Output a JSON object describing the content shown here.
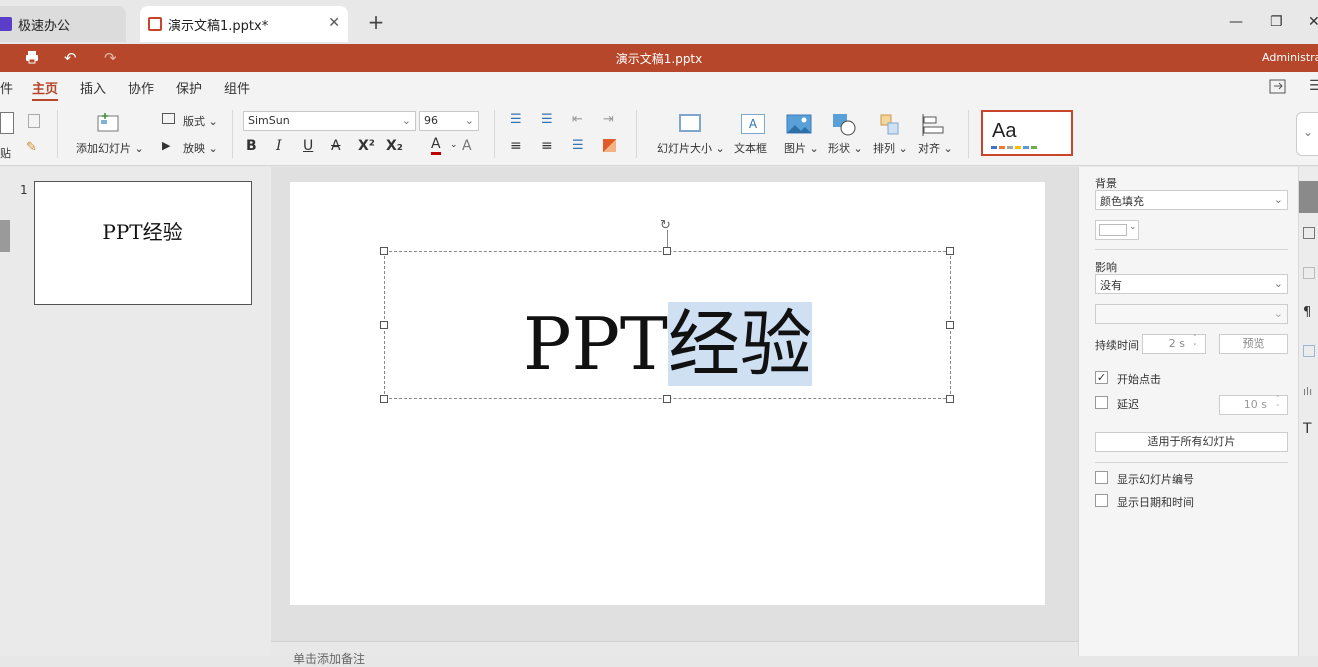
{
  "tabs": [
    {
      "label": "极速办公"
    },
    {
      "label": "演示文稿1.pptx*"
    }
  ],
  "window": {
    "title": "演示文稿1.pptx",
    "user": "Administrato"
  },
  "menu": [
    "件",
    "主页",
    "插入",
    "协作",
    "保护",
    "组件"
  ],
  "ribbon": {
    "paste_label": "贴",
    "add_slide": "添加幻灯片",
    "layout": "版式",
    "play": "放映",
    "font_name": "SimSun",
    "font_size": "96",
    "bold": "B",
    "italic": "I",
    "underline": "U",
    "strike": "A",
    "superscript": "X²",
    "subscript": "X₂",
    "font_color": "A",
    "clear_format": "A",
    "slide_size": "幻灯片大小",
    "text_box": "文本框",
    "picture": "图片",
    "shape": "形状",
    "arrange": "排列",
    "align": "对齐",
    "theme_preview": "Aa"
  },
  "slides": [
    {
      "number": "1",
      "title_text": "PPT经验"
    }
  ],
  "slide": {
    "text_plain": "PPT",
    "text_selected": "经验"
  },
  "notes_placeholder": "单击添加备注",
  "right_panel": {
    "background_title": "背景",
    "fill_select": "颜色填充",
    "effect_title": "影响",
    "effect_select": "没有",
    "effect_sub_select": "",
    "duration_label": "持续时间",
    "duration_value": "2 s",
    "preview_button": "预览",
    "start_on_click": "开始点击",
    "start_on_click_checked": true,
    "delay_label": "延迟",
    "delay_checked": false,
    "delay_value": "10 s",
    "apply_all": "适用于所有幻灯片",
    "show_slide_number": "显示幻灯片编号",
    "show_date_time": "显示日期和时间"
  },
  "colors": {
    "title_bar": "#b7472a",
    "selection": "#cfe0f3",
    "font_color_bar": "#c00000"
  }
}
